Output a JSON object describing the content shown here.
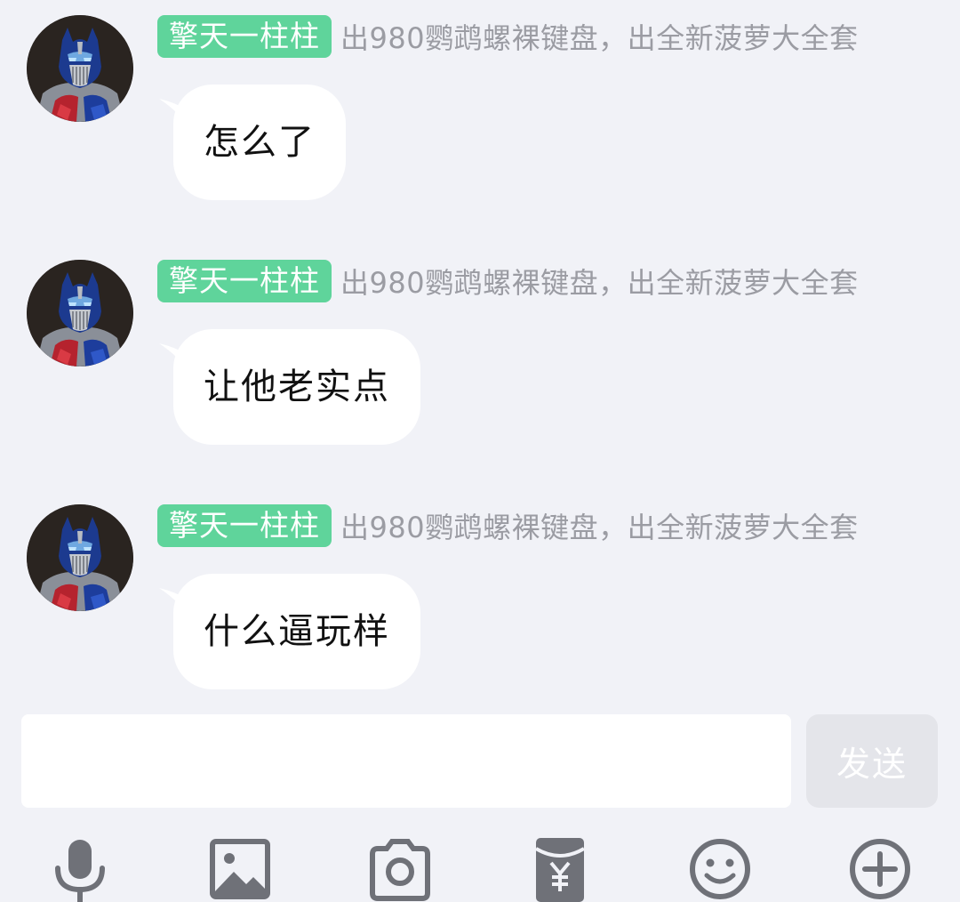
{
  "messages": [
    {
      "sender_tag": "擎天一柱柱",
      "group_name": "出980鹦鹉螺裸键盘，出全新菠萝大全套",
      "text": "怎么了"
    },
    {
      "sender_tag": "擎天一柱柱",
      "group_name": "出980鹦鹉螺裸键盘，出全新菠萝大全套",
      "text": "让他老实点"
    },
    {
      "sender_tag": "擎天一柱柱",
      "group_name": "出980鹦鹉螺裸键盘，出全新菠萝大全套",
      "text": "什么逼玩样"
    }
  ],
  "input": {
    "value": "",
    "placeholder": ""
  },
  "send_label": "发送",
  "toolbar": {
    "icons": [
      "microphone-icon",
      "image-icon",
      "camera-icon",
      "red-packet-icon",
      "emoji-icon",
      "plus-icon"
    ]
  },
  "colors": {
    "background": "#f1f2f7",
    "tag_green": "#5fd49b",
    "bubble": "#ffffff",
    "muted_text": "#9b9ca3",
    "icon_gray": "#6f7178",
    "send_disabled": "#e4e5ea"
  }
}
